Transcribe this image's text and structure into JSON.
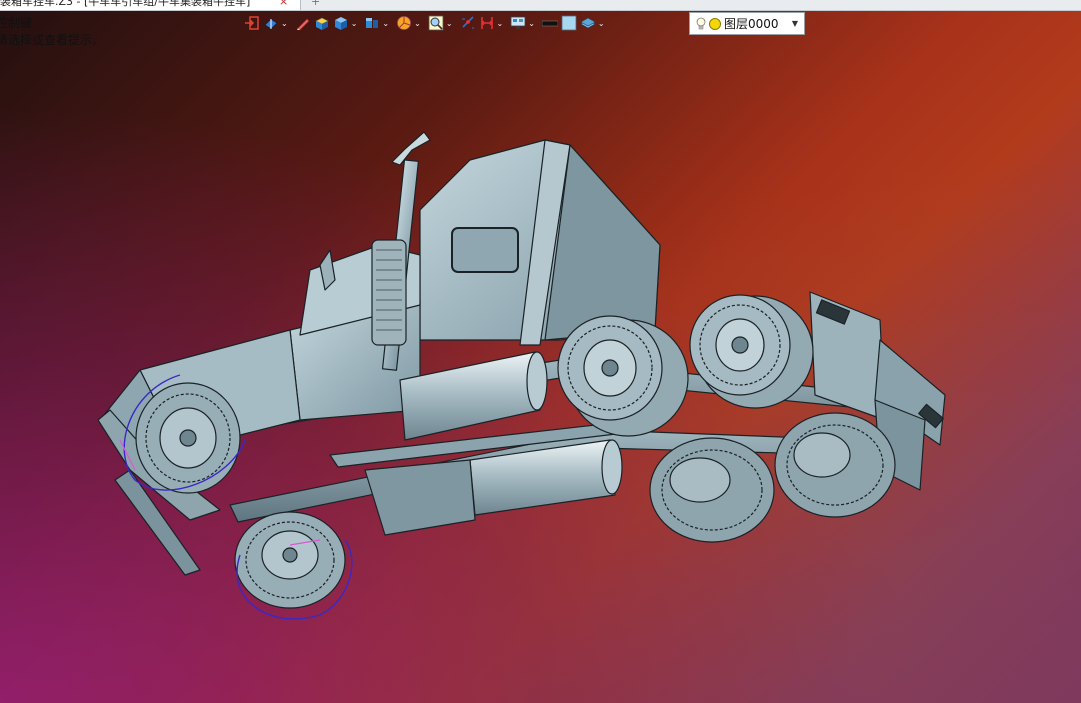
{
  "document_tab": {
    "title": "装箱车挂车.Z3 - [牛车车引车组/牛车集装箱牛挂车]",
    "close_glyph": "×",
    "add_glyph": "+"
  },
  "hints": {
    "line1": "控制键",
    "line2": "请选择或查看提示。"
  },
  "toolbar": {
    "items": [
      {
        "icon": "exit-icon"
      },
      {
        "icon": "view-orient-icon"
      },
      {
        "icon": "pen-icon"
      },
      {
        "icon": "box-yellow-icon"
      },
      {
        "icon": "cube-blue-icon"
      },
      {
        "icon": "cube-split-icon"
      },
      {
        "icon": "pie-icon"
      },
      {
        "icon": "zoom-icon"
      },
      {
        "icon": "snap-icon"
      },
      {
        "icon": "dimension-icon"
      },
      {
        "icon": "display-icon"
      },
      {
        "icon": "line-black-icon"
      },
      {
        "icon": "color-swatch-icon"
      },
      {
        "icon": "layer-stack-icon"
      }
    ],
    "colors": {
      "swatch": "#a8d8f0",
      "line": "#111111"
    }
  },
  "layer_selector": {
    "value": "图层0000",
    "bulb_icon": "lightbulb-icon",
    "dot_color": "#f5d60a"
  },
  "viewport": {
    "model": "semi-truck-tractor",
    "model_color": "#9ab3bd",
    "background_colors": [
      "#231010",
      "#b23b1c",
      "#7a2c6a"
    ]
  }
}
